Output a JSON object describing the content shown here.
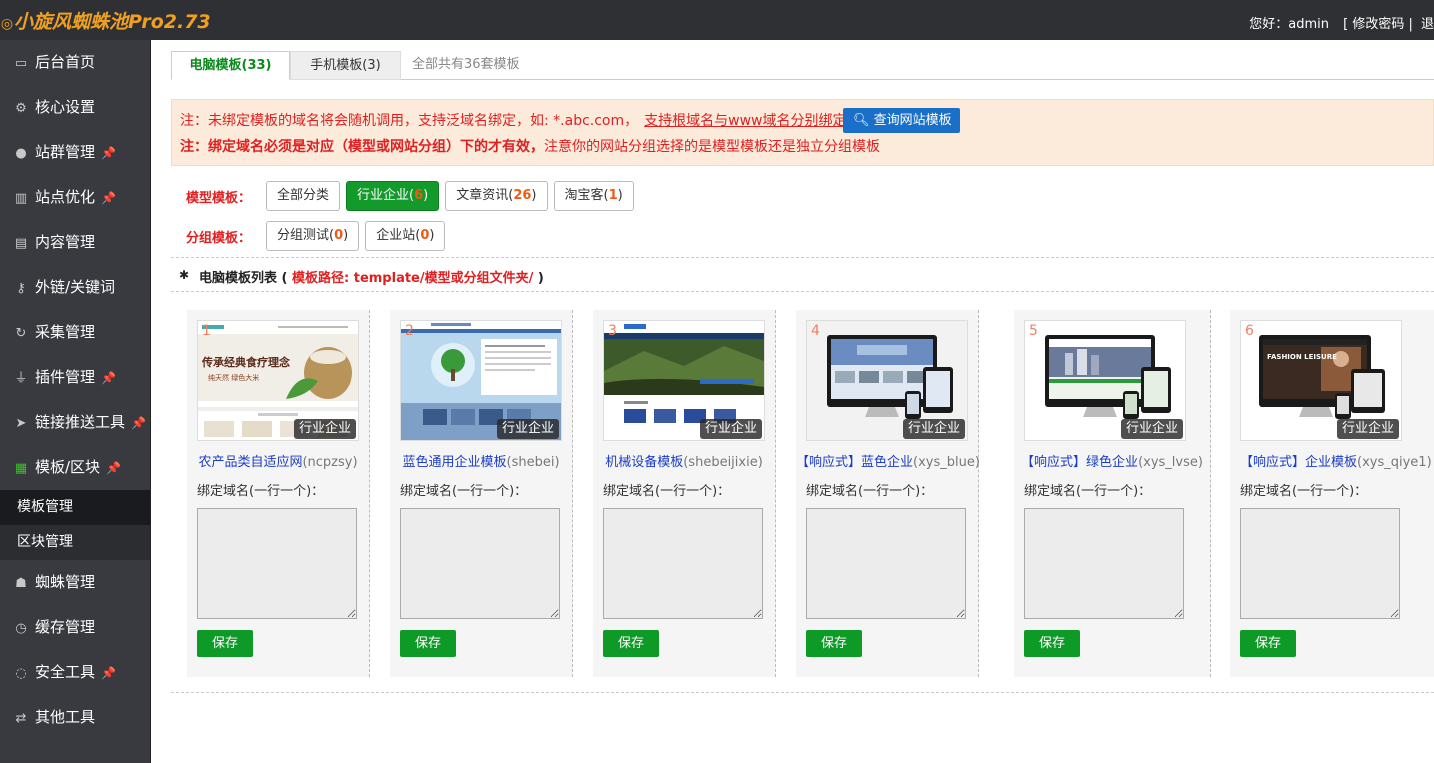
{
  "app": {
    "title": "小旋风蜘蛛池Pro2.73",
    "greeting": "您好：admin",
    "change_password": "[ 修改密码 |",
    "logout_partial": "退"
  },
  "sidebar": {
    "items": [
      {
        "label": "后台首页",
        "icon": "monitor-icon"
      },
      {
        "label": "核心设置",
        "icon": "gear-icon"
      },
      {
        "label": "站群管理",
        "icon": "user-icon",
        "pinned": true
      },
      {
        "label": "站点优化",
        "icon": "bar-chart-icon",
        "pinned": true
      },
      {
        "label": "内容管理",
        "icon": "document-icon"
      },
      {
        "label": "外链/关键词",
        "icon": "key-icon"
      },
      {
        "label": "采集管理",
        "icon": "refresh-icon"
      },
      {
        "label": "插件管理",
        "icon": "plug-icon",
        "pinned": true
      },
      {
        "label": "链接推送工具",
        "icon": "send-icon",
        "pinned": true
      },
      {
        "label": "模板/区块",
        "icon": "windows-icon",
        "pinned": true,
        "active": true
      }
    ],
    "subitems": [
      {
        "label": "模板管理",
        "active": true
      },
      {
        "label": "区块管理"
      }
    ],
    "items_after": [
      {
        "label": "蜘蛛管理",
        "icon": "android-icon"
      },
      {
        "label": "缓存管理",
        "icon": "clock-icon"
      },
      {
        "label": "安全工具",
        "icon": "bulb-icon",
        "pinned": true
      },
      {
        "label": "其他工具",
        "icon": "shuffle-icon"
      }
    ]
  },
  "tabs": {
    "pc": "电脑模板(33)",
    "mobile": "手机模板(3)",
    "total": "全部共有36套模板"
  },
  "notice": {
    "line1_prefix": "注：未绑定模板的域名将会随机调用，支持泛域名绑定，如: *.abc.com，",
    "line1_link": "支持根域名与www域名分别绑定",
    "query_button": "查询网站模板",
    "line2_bold": "注：绑定域名必须是对应（模型或网站分组）下的才有效，",
    "line2_rest": "注意你的网站分组选择的是模型模板还是独立分组模板"
  },
  "filters": {
    "model_label": "模型模板：",
    "model": [
      {
        "label": "全部分类",
        "count": null,
        "active": false
      },
      {
        "label": "行业企业",
        "count": "6",
        "active": true
      },
      {
        "label": "文章资讯",
        "count": "26",
        "active": false
      },
      {
        "label": "淘宝客",
        "count": "1",
        "active": false
      }
    ],
    "group_label": "分组模板：",
    "group": [
      {
        "label": "分组测试",
        "count": "0"
      },
      {
        "label": "企业站",
        "count": "0"
      }
    ]
  },
  "list_header": {
    "title": "电脑模板列表 (",
    "path": "模板路径: template/模型或分组文件夹/",
    "close": ")"
  },
  "templates": [
    {
      "num": "1",
      "tag": "行业企业",
      "name": "农产品类自适应网",
      "code": "(ncpzsy)",
      "bind_label": "绑定域名(一行一个)：",
      "save": "保存"
    },
    {
      "num": "2",
      "tag": "行业企业",
      "name": "蓝色通用企业模板",
      "code": "(shebei)",
      "bind_label": "绑定域名(一行一个)：",
      "save": "保存"
    },
    {
      "num": "3",
      "tag": "行业企业",
      "name": "机械设备模板",
      "code": "(shebeijixie)",
      "bind_label": "绑定域名(一行一个)：",
      "save": "保存"
    },
    {
      "num": "4",
      "tag": "行业企业",
      "name": "【响应式】蓝色企业",
      "code": "(xys_blue)",
      "bind_label": "绑定域名(一行一个)：",
      "save": "保存"
    },
    {
      "num": "5",
      "tag": "行业企业",
      "name": "【响应式】绿色企业",
      "code": "(xys_lvse)",
      "bind_label": "绑定域名(一行一个)：",
      "save": "保存"
    },
    {
      "num": "6",
      "tag": "行业企业",
      "name": "【响应式】企业模板",
      "code": "(xys_qiye1)",
      "bind_label": "绑定域名(一行一个)：",
      "save": "保存"
    }
  ],
  "thumb_text": {
    "t1_headline": "传承经典食疗理念",
    "t1_sub": "纯天然  绿色大米",
    "t5_banner": "FASHION LEISURE"
  },
  "colors": {
    "accent_green": "#129a2a",
    "notice_red": "#e02020",
    "link_blue": "#1a3cc8",
    "sidebar_bg": "#383a3f"
  }
}
